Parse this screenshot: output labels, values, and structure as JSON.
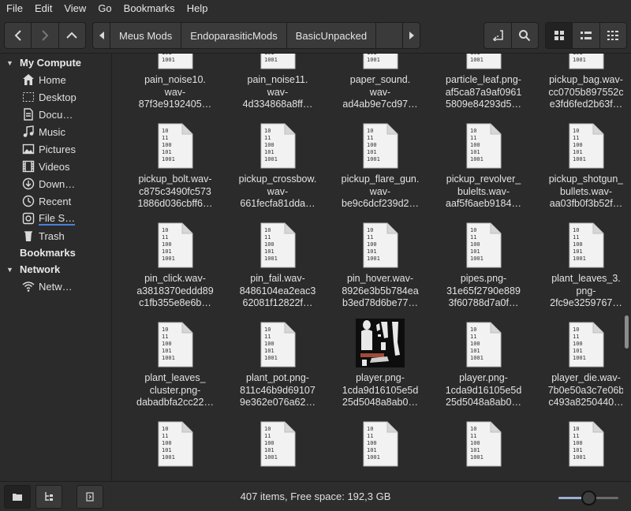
{
  "menu": [
    "File",
    "Edit",
    "View",
    "Go",
    "Bookmarks",
    "Help"
  ],
  "breadcrumbs": [
    "Meus Mods",
    "EndoparasiticMods",
    "BasicUnpacked"
  ],
  "sidebar": {
    "my_computer": "My Compute",
    "items": [
      {
        "label": "Home",
        "icon": "home-icon"
      },
      {
        "label": "Desktop",
        "icon": "desktop-icon"
      },
      {
        "label": "Docu…",
        "icon": "documents-icon"
      },
      {
        "label": "Music",
        "icon": "music-icon"
      },
      {
        "label": "Pictures",
        "icon": "pictures-icon"
      },
      {
        "label": "Videos",
        "icon": "videos-icon"
      },
      {
        "label": "Down…",
        "icon": "downloads-icon"
      },
      {
        "label": "Recent",
        "icon": "recent-icon"
      },
      {
        "label": "File S…",
        "icon": "filesystem-icon"
      },
      {
        "label": "Trash",
        "icon": "trash-icon"
      }
    ],
    "bookmarks": "Bookmarks",
    "network": "Network",
    "network_items": [
      {
        "label": "Netw…",
        "icon": "wifi-icon"
      }
    ]
  },
  "files": [
    [
      "pain_noise10.",
      "wav-",
      "87f3e9192405…"
    ],
    [
      "pain_noise11.",
      "wav-",
      "4d334868a8ff…"
    ],
    [
      "paper_sound.",
      "wav-",
      "ad4ab9e7cd97…"
    ],
    [
      "particle_leaf.png-",
      "af5ca87a9af0961",
      "5809e84293d5…"
    ],
    [
      "pickup_bag.wav-",
      "cc0705b897552c",
      "e3fd6fed2b63f…"
    ],
    [
      "pickup_bolt.wav-",
      "c875c3490fc573",
      "1886d036cbff6…"
    ],
    [
      "pickup_crossbow.",
      "wav-",
      "661fecfa81dda…"
    ],
    [
      "pickup_flare_gun.",
      "wav-",
      "be9c6dcf239d2…"
    ],
    [
      "pickup_revolver_",
      "bulelts.wav-",
      "aaf5f6aeb9184…"
    ],
    [
      "pickup_shotgun_",
      "bullets.wav-",
      "aa03fb0f3b52f…"
    ],
    [
      "pin_click.wav-",
      "a3818370eddd89",
      "c1fb355e8e6b…"
    ],
    [
      "pin_fail.wav-",
      "8486104ea2eac3",
      "62081f12822f…"
    ],
    [
      "pin_hover.wav-",
      "8926e3b5b784ea",
      "b3ed78d6be77…"
    ],
    [
      "pipes.png-",
      "31e65f2790e889",
      "3f60788d7a0f…"
    ],
    [
      "plant_leaves_3.",
      "png-",
      "2fc9e3259767…"
    ],
    [
      "plant_leaves_",
      "cluster.png-",
      "dabadbfa2cc22…"
    ],
    [
      "plant_pot.png-",
      "811c46b9d69107",
      "9e362e076a62…"
    ],
    [
      "player.png-",
      "1cda9d16105e5d",
      "25d5048a8ab0…"
    ],
    [
      "player.png-",
      "1cda9d16105e5d",
      "25d5048a8ab0…"
    ],
    [
      "player_die.wav-",
      "7b0e50a3c7e06b",
      "c493a8250440…"
    ],
    [],
    [],
    [],
    [],
    []
  ],
  "thumbnail_index": 17,
  "status": "407 items, Free space: 192,3 GB",
  "zoom_fraction": 0.5,
  "colors": {
    "bg": "#2b2b2b",
    "accent": "#9ab0d0"
  }
}
